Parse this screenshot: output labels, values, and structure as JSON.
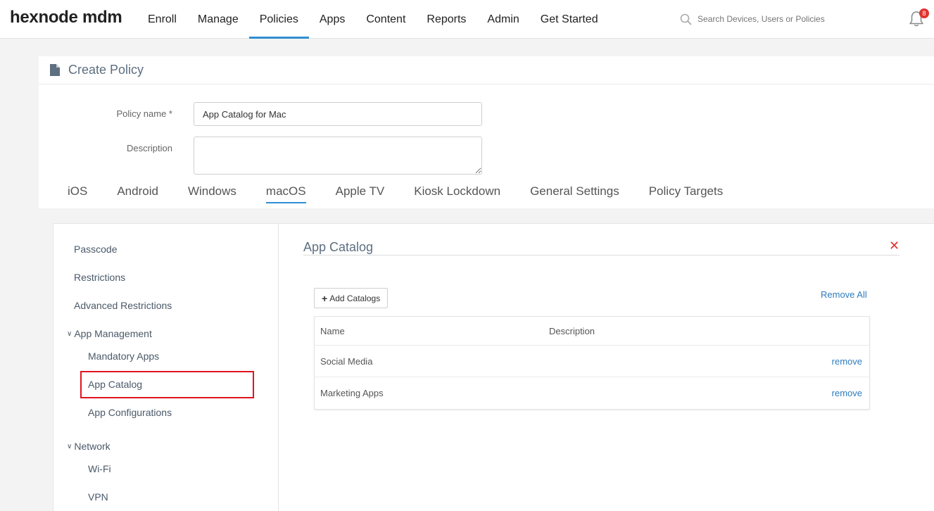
{
  "brand": {
    "logo": "hexnode mdm"
  },
  "nav": {
    "items": [
      {
        "label": "Enroll",
        "active": false
      },
      {
        "label": "Manage",
        "active": false
      },
      {
        "label": "Policies",
        "active": true
      },
      {
        "label": "Apps",
        "active": false
      },
      {
        "label": "Content",
        "active": false
      },
      {
        "label": "Reports",
        "active": false
      },
      {
        "label": "Admin",
        "active": false
      },
      {
        "label": "Get Started",
        "active": false
      }
    ],
    "search_placeholder": "Search Devices, Users or Policies",
    "notification_count": "8"
  },
  "page": {
    "title": "Create Policy",
    "policy_name_label": "Policy name *",
    "policy_name_value": "App Catalog for Mac",
    "description_label": "Description",
    "description_value": ""
  },
  "tabs": [
    {
      "label": "iOS",
      "active": false
    },
    {
      "label": "Android",
      "active": false
    },
    {
      "label": "Windows",
      "active": false
    },
    {
      "label": "macOS",
      "active": true
    },
    {
      "label": "Apple TV",
      "active": false
    },
    {
      "label": "Kiosk Lockdown",
      "active": false
    },
    {
      "label": "General Settings",
      "active": false
    },
    {
      "label": "Policy Targets",
      "active": false
    }
  ],
  "sidebar": {
    "passcode": "Passcode",
    "restrictions": "Restrictions",
    "advanced_restrictions": "Advanced Restrictions",
    "app_management": "App Management",
    "mandatory_apps": "Mandatory Apps",
    "app_catalog": "App Catalog",
    "app_configurations": "App Configurations",
    "network": "Network",
    "wifi": "Wi-Fi",
    "vpn": "VPN"
  },
  "main": {
    "title": "App Catalog",
    "add_button": "Add Catalogs",
    "remove_all": "Remove All",
    "columns": {
      "name": "Name",
      "description": "Description"
    },
    "rows": [
      {
        "name": "Social Media",
        "description": "",
        "action": "remove"
      },
      {
        "name": "Marketing Apps",
        "description": "",
        "action": "remove"
      }
    ]
  }
}
